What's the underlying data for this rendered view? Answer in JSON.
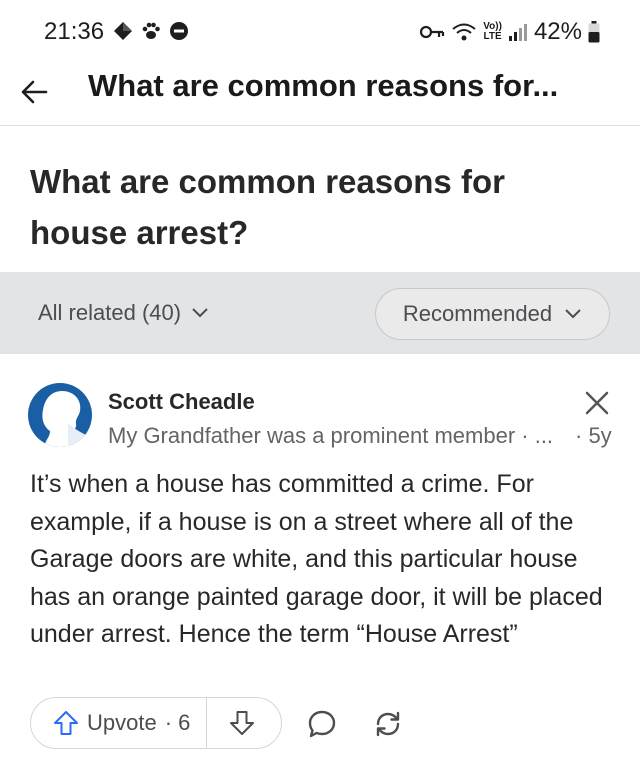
{
  "status_bar": {
    "time": "21:36",
    "lte_top": "Vo))",
    "lte_bottom": "LTE",
    "battery_percent": "42%"
  },
  "header": {
    "title": "What are common reasons for..."
  },
  "question": {
    "title": "What are common reasons for house arrest?"
  },
  "filters": {
    "all_related_label": "All related (40)",
    "sort_label": "Recommended"
  },
  "answer": {
    "author_name": "Scott Cheadle",
    "author_credential": "My Grandfather was a prominent member · ...",
    "age": "· 5y",
    "body": "It’s when a house has committed a crime. For example, if a house is on a street where all of the Garage doors are white, and this particular house has an orange painted garage door, it will be placed under arrest. Hence the term “House Arrest”",
    "upvote_label": "Upvote",
    "upvote_count": "· 6"
  },
  "colors": {
    "avatar_blue": "#1a5fa6",
    "filter_bar_bg": "#e3e4e5",
    "text_primary": "#282828",
    "text_secondary": "#636466"
  },
  "icons": [
    "location-icon",
    "paw-icon",
    "do-not-disturb-icon",
    "vpn-key-icon",
    "wifi-icon",
    "signal-icon",
    "battery-icon",
    "back-arrow-icon",
    "chevron-down-icon",
    "close-icon",
    "upvote-arrow-icon",
    "downvote-arrow-icon",
    "comment-icon",
    "share-icon"
  ]
}
